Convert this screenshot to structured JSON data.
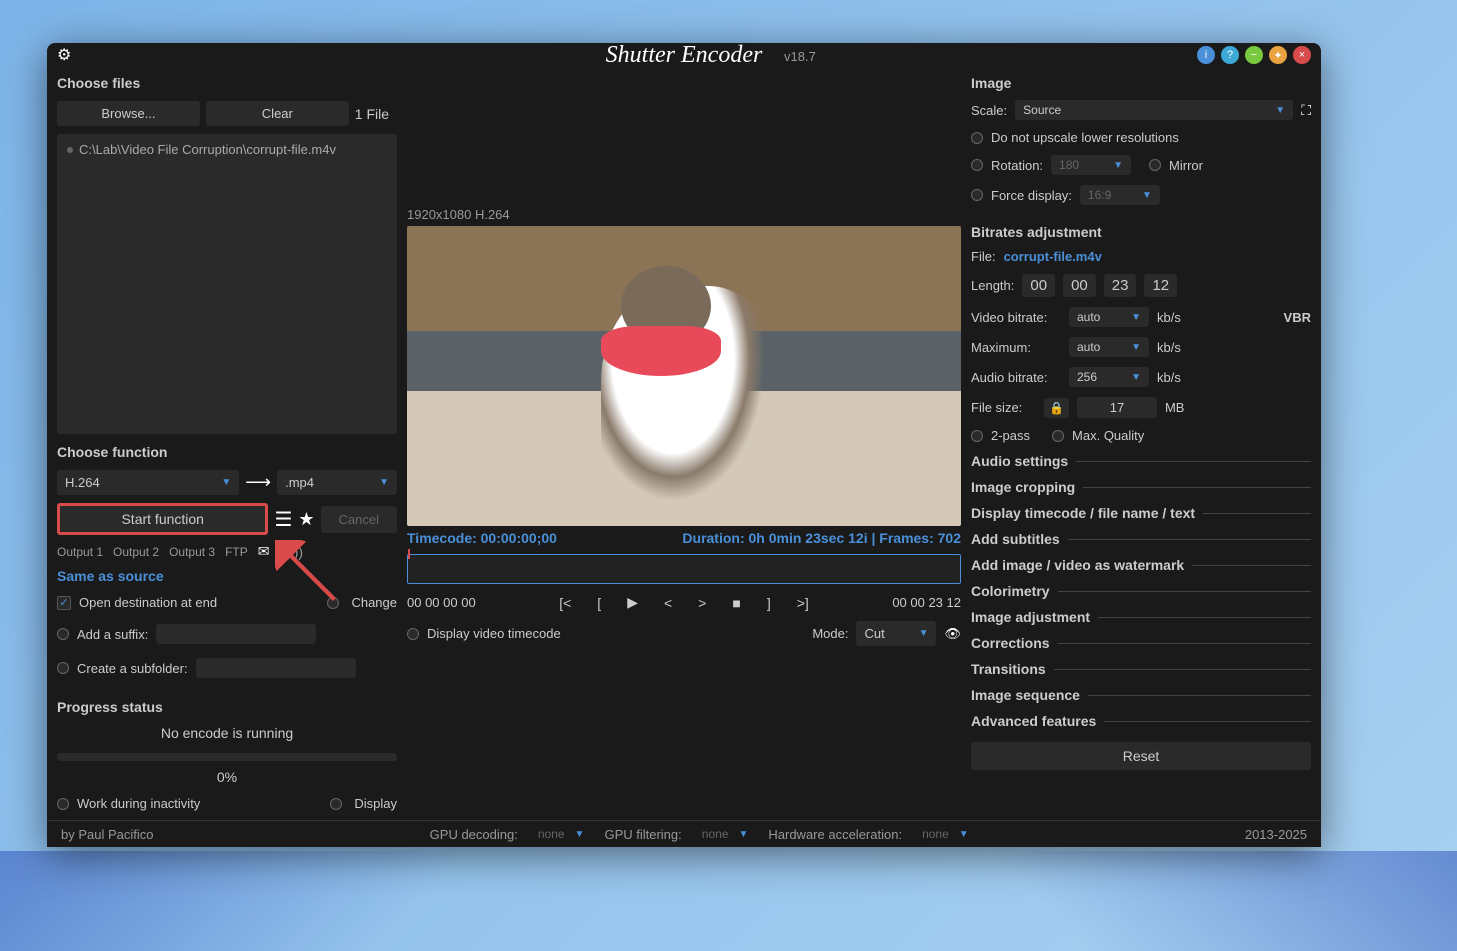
{
  "app": {
    "title": "Shutter Encoder",
    "version": "v18.7"
  },
  "files": {
    "section": "Choose files",
    "browse": "Browse...",
    "clear": "Clear",
    "count": "1 File",
    "path": "C:\\Lab\\Video File Corruption\\corrupt-file.m4v"
  },
  "function": {
    "section": "Choose function",
    "codec": "H.264",
    "ext": ".mp4",
    "start": "Start function",
    "cancel": "Cancel"
  },
  "output": {
    "tab1": "Output 1",
    "tab2": "Output 2",
    "tab3": "Output 3",
    "ftp": "FTP",
    "same": "Same as source",
    "open_dest": "Open destination at end",
    "change": "Change",
    "suffix": "Add a suffix:",
    "subfolder": "Create a subfolder:"
  },
  "progress": {
    "section": "Progress status",
    "status": "No encode is running",
    "percent": "0%",
    "inactivity": "Work during inactivity",
    "display": "Display"
  },
  "preview": {
    "resolution": "1920x1080 H.264",
    "timecode_label": "Timecode: 00:00:00;00",
    "duration_label": "Duration: 0h 0min 23sec 12i | Frames: 702",
    "time_left": "00 00 00 00",
    "time_right": "00 00 23 12",
    "display_tc": "Display video timecode",
    "mode_label": "Mode:",
    "mode_value": "Cut"
  },
  "image": {
    "section": "Image",
    "scale": "Scale:",
    "scale_val": "Source",
    "no_upscale": "Do not upscale lower resolutions",
    "rotation": "Rotation:",
    "rotation_val": "180",
    "mirror": "Mirror",
    "force": "Force display:",
    "force_val": "16:9"
  },
  "bitrates": {
    "section": "Bitrates adjustment",
    "file_label": "File:",
    "file_val": "corrupt-file.m4v",
    "length": "Length:",
    "h": "00",
    "m": "00",
    "s": "23",
    "f": "12",
    "video_bitrate": "Video bitrate:",
    "video_val": "auto",
    "maximum": "Maximum:",
    "max_val": "auto",
    "audio_bitrate": "Audio bitrate:",
    "audio_val": "256",
    "filesize": "File size:",
    "filesize_val": "17",
    "kbs": "kb/s",
    "mb": "MB",
    "vbr": "VBR",
    "twopass": "2-pass",
    "maxq": "Max. Quality"
  },
  "accordions": {
    "audio": "Audio settings",
    "cropping": "Image cropping",
    "timecode": "Display timecode / file name / text",
    "subtitles": "Add subtitles",
    "watermark": "Add image / video as watermark",
    "colorimetry": "Colorimetry",
    "adjustment": "Image adjustment",
    "corrections": "Corrections",
    "transitions": "Transitions",
    "sequence": "Image sequence",
    "advanced": "Advanced features",
    "reset": "Reset"
  },
  "status": {
    "author": "by Paul Pacifico",
    "gpu_dec": "GPU decoding:",
    "gpu_filt": "GPU filtering:",
    "hw_accel": "Hardware acceleration:",
    "none": "none",
    "years": "2013-2025"
  }
}
